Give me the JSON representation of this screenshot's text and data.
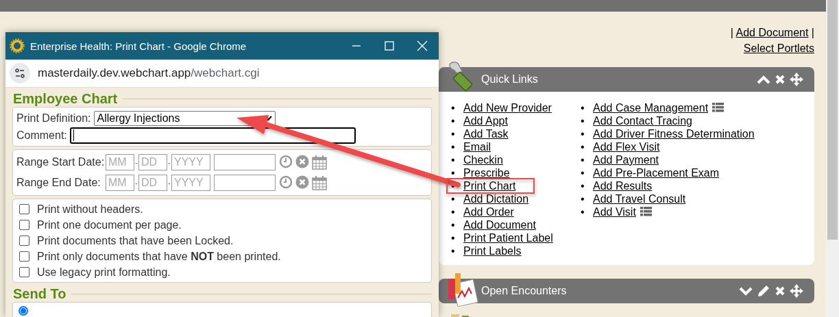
{
  "top_links": [
    {
      "items": [
        {
          "kind": "separator",
          "text": "|"
        },
        {
          "kind": "link",
          "text": "Add Document"
        },
        {
          "kind": "separator",
          "text": "|"
        }
      ]
    },
    {
      "items": [
        {
          "kind": "link",
          "text": "Select Portlets"
        }
      ]
    }
  ],
  "portlets": [
    {
      "title": "Quick Links",
      "expanded": true,
      "editable": false,
      "marker": "•",
      "columns": [
        [
          {
            "text": "Add New Provider",
            "list_icon": false
          },
          {
            "text": "Add Appt",
            "list_icon": false
          },
          {
            "text": "Add Task",
            "list_icon": false
          },
          {
            "text": "Email",
            "list_icon": false
          },
          {
            "text": "Checkin",
            "list_icon": false
          },
          {
            "text": "Prescribe",
            "list_icon": false
          },
          {
            "text": "Print Chart",
            "list_icon": false
          },
          {
            "text": "Add Dictation",
            "list_icon": false
          },
          {
            "text": "Add Order",
            "list_icon": false
          },
          {
            "text": "Add Document",
            "list_icon": false
          },
          {
            "text": "Print Patient Label",
            "list_icon": false
          },
          {
            "text": "Print Labels",
            "list_icon": false
          }
        ],
        [
          {
            "text": "Add Case Management",
            "list_icon": true
          },
          {
            "text": "Add Contact Tracing",
            "list_icon": false
          },
          {
            "text": "Add Driver Fitness Determination",
            "list_icon": false
          },
          {
            "text": "Add Flex Visit",
            "list_icon": false
          },
          {
            "text": "Add Payment",
            "list_icon": false
          },
          {
            "text": "Add Pre-Placement Exam",
            "list_icon": false
          },
          {
            "text": "Add Results",
            "list_icon": false
          },
          {
            "text": "Add Travel Consult",
            "list_icon": false
          },
          {
            "text": "Add Visit",
            "list_icon": true
          }
        ]
      ]
    },
    {
      "title": "Open Encounters",
      "expanded": false,
      "editable": true
    }
  ],
  "popup": {
    "title": "Enterprise Health: Print Chart - Google Chrome",
    "url_host": "masterdaily.dev.webchart.app",
    "url_path": "/webchart.cgi",
    "employee_chart": {
      "title": "Employee Chart",
      "print_definition": {
        "label": "Print Definition:",
        "value": "Allergy Injections"
      },
      "comment": {
        "label": "Comment:"
      },
      "date_ranges": [
        {
          "label": "Range Start Date:",
          "month": "MM",
          "day": "DD",
          "year": "YYYY",
          "separator": "-"
        },
        {
          "label": "Range End Date:",
          "month": "MM",
          "day": "DD",
          "year": "YYYY",
          "separator": "-"
        }
      ],
      "options": [
        {
          "text": "Print without headers.",
          "checked": false
        },
        {
          "text": "Print one document per page.",
          "checked": false
        },
        {
          "text": "Print documents that have been Locked.",
          "checked": false
        },
        {
          "text": "Print only documents that have **NOT** been printed.",
          "checked": false
        },
        {
          "text": "Use legacy print formatting.",
          "checked": false
        }
      ]
    },
    "send_to": {
      "title": "Send To",
      "options": [
        {
          "selected": true
        }
      ]
    }
  }
}
